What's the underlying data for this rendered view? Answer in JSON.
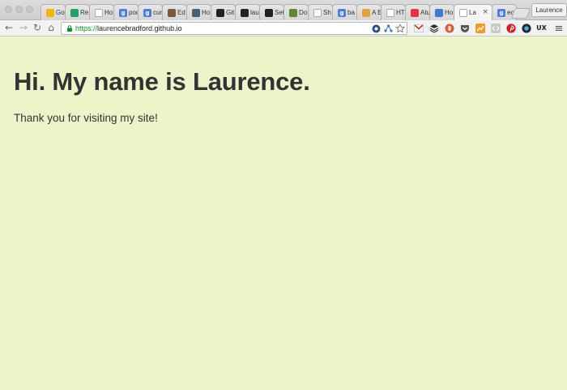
{
  "window": {
    "profile_name": "Laurence"
  },
  "tabs": [
    {
      "label": "Go",
      "icon": "google-keep-icon",
      "color": "#f4b400",
      "glyph": ""
    },
    {
      "label": "Re",
      "icon": "google-drive-icon",
      "color": "#1fa463",
      "glyph": ""
    },
    {
      "label": "Ho",
      "icon": "page-icon",
      "color": "#ffffff",
      "glyph": ""
    },
    {
      "label": "poo",
      "icon": "google-search-icon",
      "color": "#4a7de0",
      "glyph": "g"
    },
    {
      "label": "cur",
      "icon": "google-search-icon",
      "color": "#4a7de0",
      "glyph": "g"
    },
    {
      "label": "Ed",
      "icon": "avatar-icon",
      "color": "#7a5a3a",
      "glyph": ""
    },
    {
      "label": "Ho",
      "icon": "avatar-icon",
      "color": "#4d5e7a",
      "glyph": ""
    },
    {
      "label": "Git",
      "icon": "github-icon",
      "color": "#222222",
      "glyph": ""
    },
    {
      "label": "lau",
      "icon": "github-icon",
      "color": "#222222",
      "glyph": ""
    },
    {
      "label": "Set",
      "icon": "github-icon",
      "color": "#222222",
      "glyph": ""
    },
    {
      "label": "Do",
      "icon": "document-icon",
      "color": "#5c8a2e",
      "glyph": ""
    },
    {
      "label": "Sh",
      "icon": "page-icon",
      "color": "#ffffff",
      "glyph": ""
    },
    {
      "label": "ba",
      "icon": "google-search-icon",
      "color": "#4a7de0",
      "glyph": "g"
    },
    {
      "label": "A E",
      "icon": "lightning-icon",
      "color": "#e8a13a",
      "glyph": ""
    },
    {
      "label": "HT",
      "icon": "page-icon",
      "color": "#ffffff",
      "glyph": ""
    },
    {
      "label": "Atu",
      "icon": "record-icon",
      "color": "#e0363a",
      "glyph": ""
    },
    {
      "label": "Ho",
      "icon": "wave-icon",
      "color": "#3a7bd5",
      "glyph": ""
    },
    {
      "label": "La",
      "icon": "page-icon",
      "color": "#ffffff",
      "glyph": "",
      "active": true,
      "close": "×"
    },
    {
      "label": "ecl",
      "icon": "google-search-icon",
      "color": "#4a7de0",
      "glyph": "g"
    }
  ],
  "toolbar": {
    "back_glyph": "←",
    "forward_glyph": "→",
    "reload_glyph": "↻",
    "home_glyph": "⌂",
    "menu_glyph": "≡"
  },
  "omnibox": {
    "scheme": "https://",
    "host": "laurencebradford.github.io"
  },
  "page": {
    "heading": "Hi. My name is Laurence.",
    "subtext": "Thank you for visiting my site!",
    "background": "#ecf5c9"
  }
}
